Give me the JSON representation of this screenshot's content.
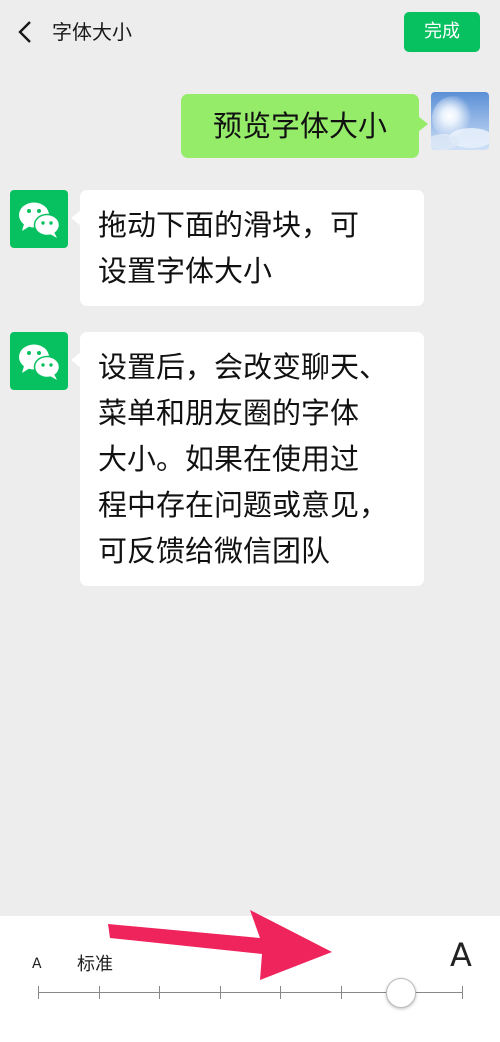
{
  "header": {
    "title": "字体大小",
    "done_label": "完成"
  },
  "messages": [
    {
      "from": "me",
      "text": "预览字体大小"
    },
    {
      "from": "bot",
      "lines": [
        "拖动下面的滑块，可",
        "设置字体大小"
      ]
    },
    {
      "from": "bot",
      "lines": [
        "设置后，会改变聊天、",
        "菜单和朋友圈的字体",
        "大小。如果在使用过",
        "程中存在问题或意见，",
        "可反馈给微信团队"
      ]
    }
  ],
  "font_slider": {
    "small_label": "A",
    "standard_label": "标准",
    "large_label": "A",
    "levels": 8,
    "selected_level": 6
  },
  "colors": {
    "accent": "#07c160",
    "bubble_me": "#95ec69",
    "annotation_arrow": "#f0245c"
  }
}
